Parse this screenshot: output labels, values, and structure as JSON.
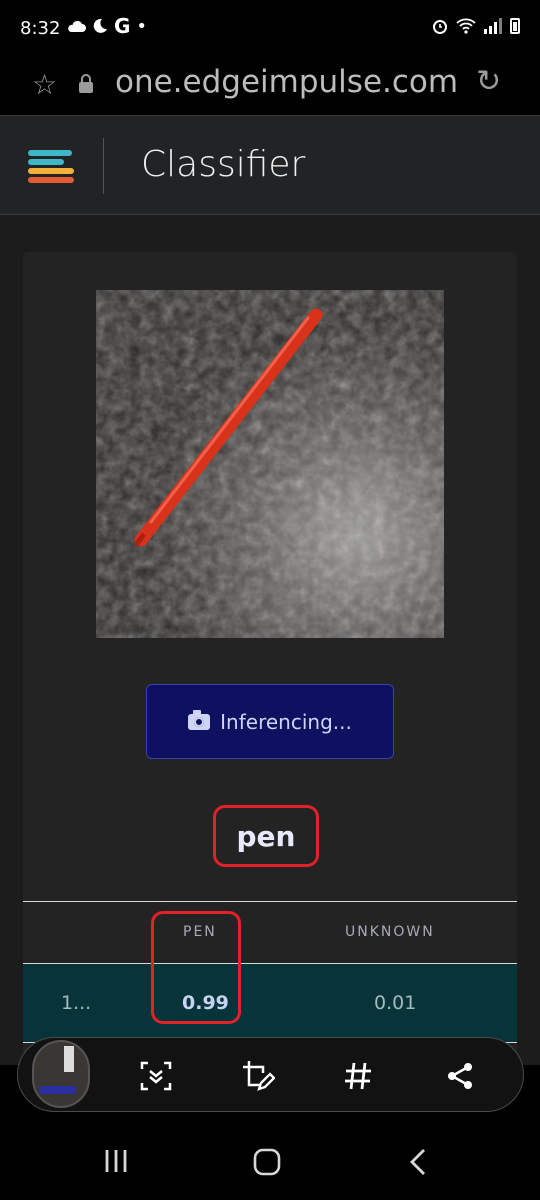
{
  "status": {
    "time": "8:32",
    "left_icons": [
      "cloud-icon",
      "moon-icon",
      "google-icon",
      "dot-icon"
    ],
    "right_icons": [
      "alarm-icon",
      "wifi-icon",
      "signal-icon",
      "battery-icon"
    ]
  },
  "browser": {
    "url": "one.edgeimpulse.com"
  },
  "app": {
    "title": "Classifier"
  },
  "classifier": {
    "button_label": "Inferencing...",
    "result_label": "pen",
    "table": {
      "headers": [
        "",
        "PEN",
        "UNKNOWN"
      ],
      "rows": [
        [
          "1...",
          "0.99",
          "0.01"
        ]
      ]
    }
  },
  "colors": {
    "accent_button": "#0e1160",
    "highlight": "#e3212a",
    "row_bg": "#063438"
  }
}
